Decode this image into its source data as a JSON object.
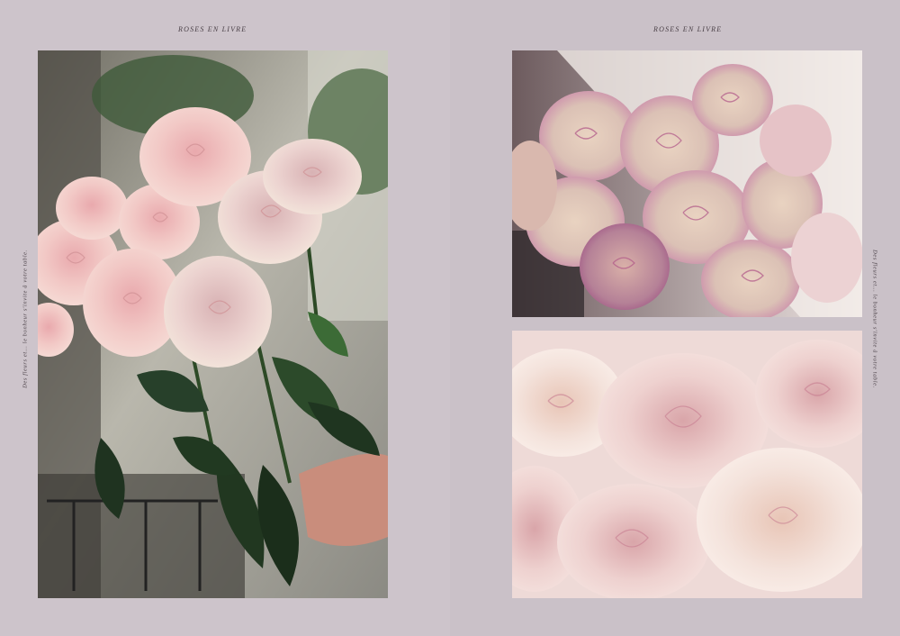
{
  "running_heads": {
    "left": "ROSES EN LIVRE",
    "right": "ROSES EN LIVRE"
  },
  "side_captions": {
    "left": "Des fleurs et... le bonheur s'invite à votre table.",
    "right": "Des fleurs et... le bonheur s'invite à votre table."
  },
  "photos": {
    "main": {
      "subject": "bouquet of pale pink garden roses with dark green leaves, held in hand"
    },
    "top": {
      "subject": "cluster of cream and magenta-edged roses"
    },
    "bottom": {
      "subject": "close-up of blush pink ruffled roses"
    }
  },
  "colors": {
    "page_bg": "#cdc4cb",
    "text": "#4a4047",
    "rose_pink": "#f0c6c4",
    "rose_cream": "#f3dcd3",
    "rose_magenta": "#c85a95",
    "leaf_green": "#253a24"
  }
}
